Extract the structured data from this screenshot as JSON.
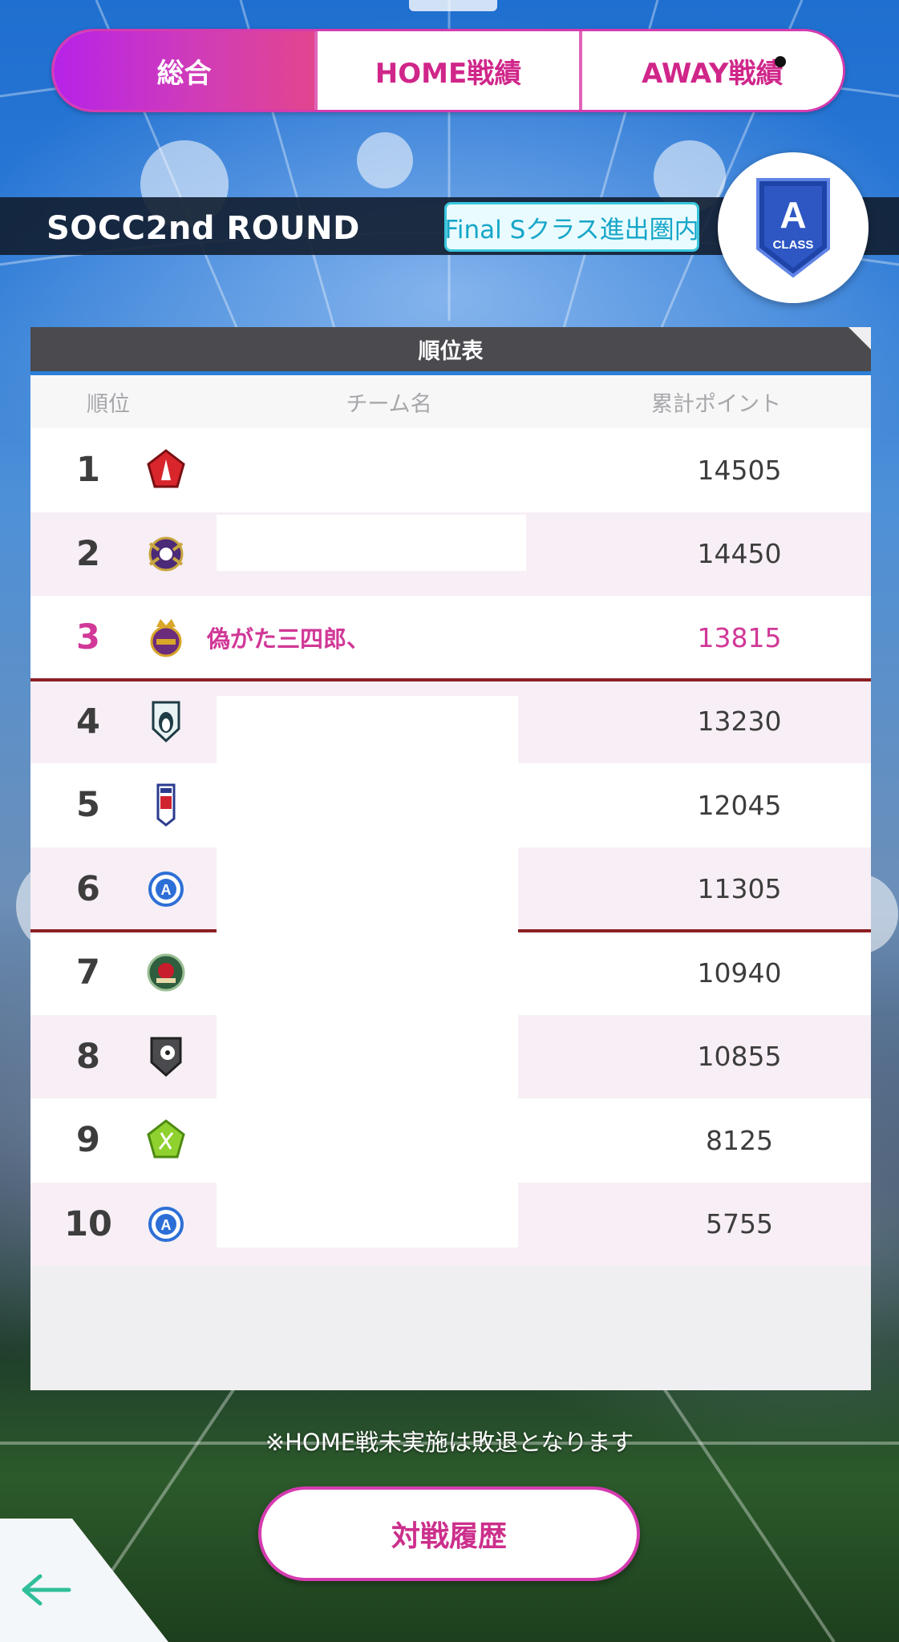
{
  "tabs": [
    {
      "label": "総合",
      "active": true
    },
    {
      "label": "HOME戦績",
      "active": false
    },
    {
      "label": "AWAY戦績",
      "active": false
    }
  ],
  "round": {
    "title": "SOCC2nd ROUND",
    "badge": "Final Sクラス進出圏内",
    "class_letter": "A",
    "class_word": "CLASS"
  },
  "table": {
    "title": "順位表",
    "headers": {
      "rank": "順位",
      "team": "チーム名",
      "points": "累計ポイント"
    },
    "rows": [
      {
        "rank": "1",
        "team": "",
        "points": "14505",
        "emblem": "red-pentagon-icon"
      },
      {
        "rank": "2",
        "team": "",
        "points": "14450",
        "emblem": "purple-crest-icon"
      },
      {
        "rank": "3",
        "team": "偽がた三四郎、",
        "points": "13815",
        "emblem": "crown-crest-icon"
      },
      {
        "rank": "4",
        "team": "",
        "points": "13230",
        "emblem": "penguin-shield-icon"
      },
      {
        "rank": "5",
        "team": "",
        "points": "12045",
        "emblem": "tall-shield-icon"
      },
      {
        "rank": "6",
        "team": "",
        "points": "11305",
        "emblem": "blue-a-emblem-icon"
      },
      {
        "rank": "7",
        "team": "",
        "points": "10940",
        "emblem": "green-rose-emblem-icon"
      },
      {
        "rank": "8",
        "team": "",
        "points": "10855",
        "emblem": "grey-ball-shield-icon"
      },
      {
        "rank": "9",
        "team": "",
        "points": "8125",
        "emblem": "lime-pentagon-icon"
      },
      {
        "rank": "10",
        "team": "",
        "points": "5755",
        "emblem": "blue-a-emblem-icon"
      }
    ]
  },
  "note": "※HOME戦未実施は敗退となります",
  "history_button": "対戦履歴",
  "colors": {
    "accent": "#d13897",
    "active_tab_start": "#b623e8",
    "badge": "#16a6c8",
    "cut_line": "#8d1f24"
  }
}
